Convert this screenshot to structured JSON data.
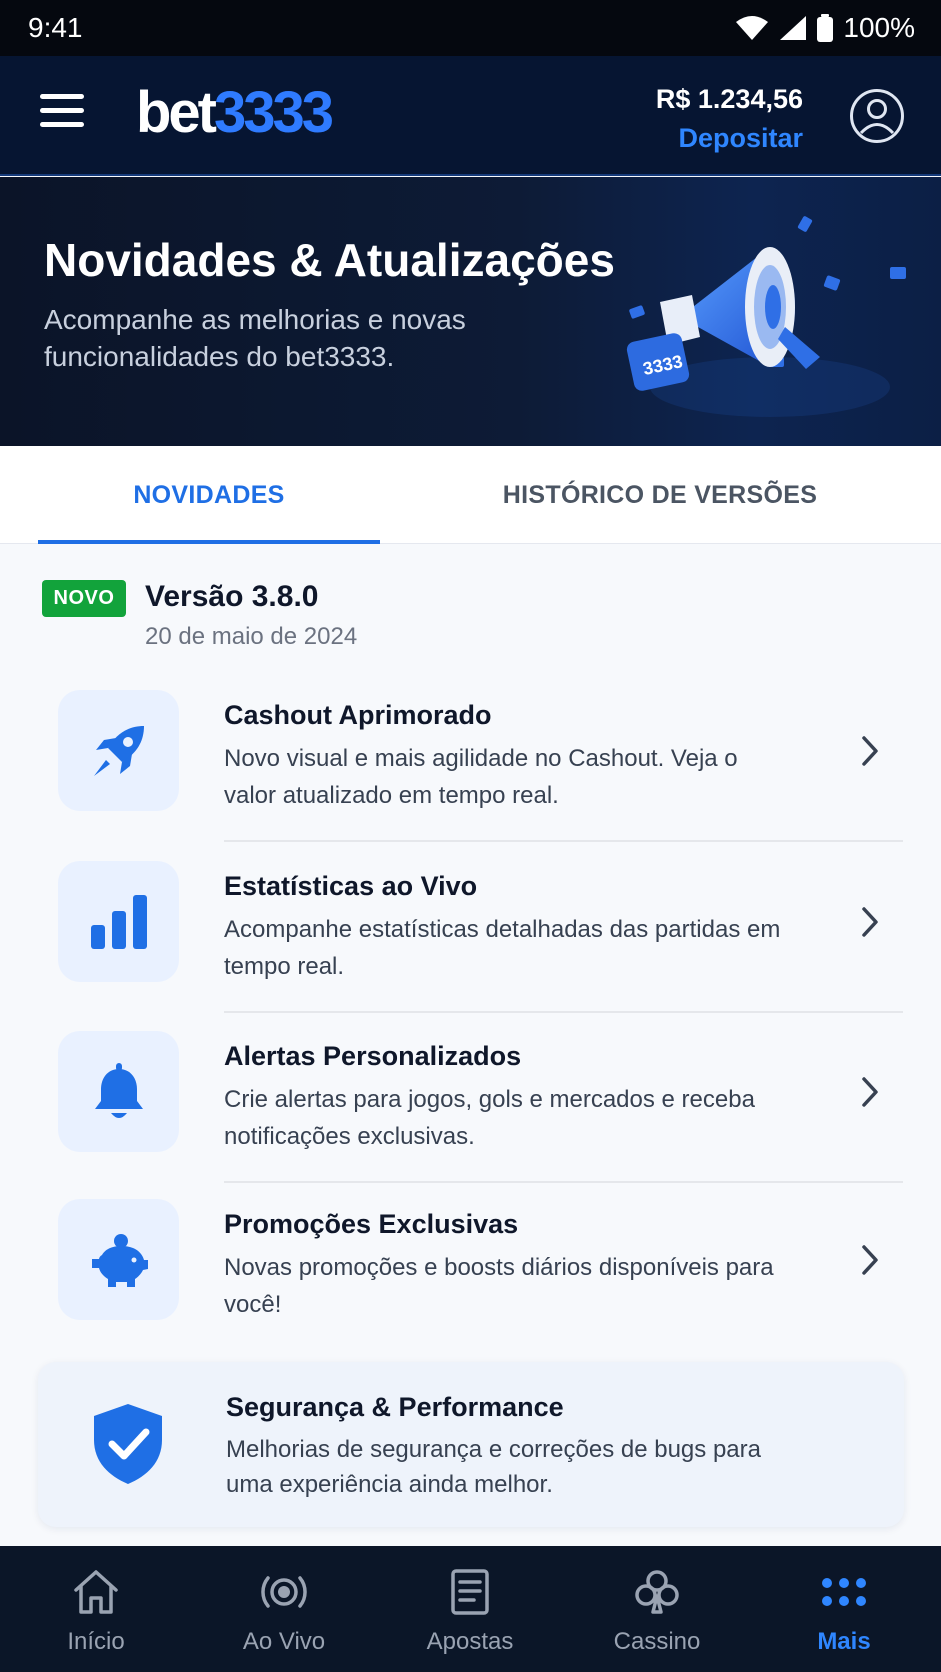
{
  "status_bar": {
    "time": "9:41",
    "battery": "100%"
  },
  "header": {
    "logo_part1": "bet",
    "logo_part2": "3333",
    "balance": "R$ 1.234,56",
    "deposit_label": "Depositar"
  },
  "hero": {
    "title": "Novidades & Atualizações",
    "subtitle": "Acompanhe as melhorias e novas funcionalidades do bet3333.",
    "art_badge": "3333"
  },
  "tabs": [
    {
      "label": "NOVIDADES",
      "active": true
    },
    {
      "label": "HISTÓRICO DE VERSÕES",
      "active": false
    }
  ],
  "release": {
    "badge": "NOVO",
    "version": "Versão 3.8.0",
    "date": "20 de maio de 2024"
  },
  "features": [
    {
      "icon": "rocket-icon",
      "title": "Cashout Aprimorado",
      "description": "Novo visual e mais agilidade no Cashout. Veja o valor atualizado em tempo real."
    },
    {
      "icon": "bar-chart-icon",
      "title": "Estatísticas ao Vivo",
      "description": "Acompanhe estatísticas detalhadas das partidas em tempo real."
    },
    {
      "icon": "bell-icon",
      "title": "Alertas Personalizados",
      "description": "Crie alertas para jogos, gols e mercados e receba notificações exclusivas."
    },
    {
      "icon": "piggy-bank-icon",
      "title": "Promoções Exclusivas",
      "description": "Novas promoções e boosts diários disponíveis para você!"
    }
  ],
  "security": {
    "icon": "shield-check-icon",
    "title": "Segurança & Performance",
    "description": "Melhorias de segurança e correções de bugs para uma experiência ainda melhor."
  },
  "bottom_nav": [
    {
      "icon": "home-icon",
      "label": "Início",
      "active": false
    },
    {
      "icon": "live-icon",
      "label": "Ao Vivo",
      "active": false
    },
    {
      "icon": "bets-icon",
      "label": "Apostas",
      "active": false
    },
    {
      "icon": "club-icon",
      "label": "Cassino",
      "active": false
    },
    {
      "icon": "more-icon",
      "label": "Mais",
      "active": true
    }
  ],
  "colors": {
    "accent": "#1f6fe5",
    "header_bg": "#061532",
    "badge_new": "#12a33b",
    "icon_box": "#e9f1ff"
  }
}
